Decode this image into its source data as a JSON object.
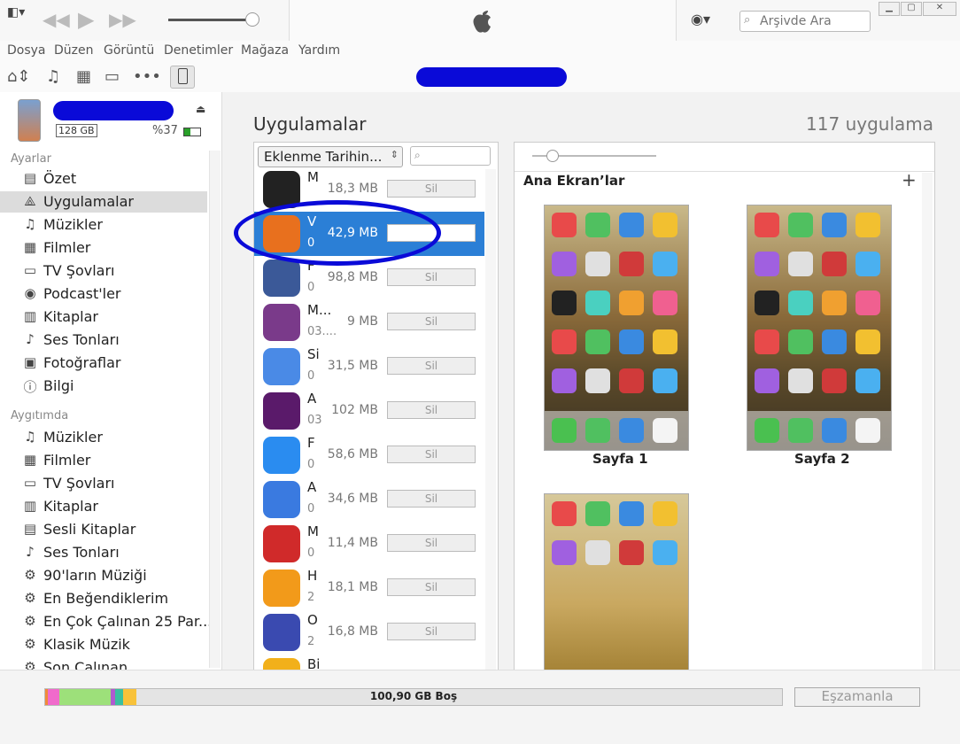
{
  "search": {
    "placeholder": "Arşivde Ara"
  },
  "menu": [
    "Dosya",
    "Düzen",
    "Görüntü",
    "Denetimler",
    "Mağaza",
    "Yardım"
  ],
  "device": {
    "capacity": "128 GB",
    "battery": "%37"
  },
  "sidebar": {
    "section_settings": "Ayarlar",
    "settings_items": [
      {
        "label": "Özet",
        "icon": "▤"
      },
      {
        "label": "Uygulamalar",
        "icon": "⟁"
      },
      {
        "label": "Müzikler",
        "icon": "♫"
      },
      {
        "label": "Filmler",
        "icon": "▦"
      },
      {
        "label": "TV Şovları",
        "icon": "▭"
      },
      {
        "label": "Podcast'ler",
        "icon": "◉"
      },
      {
        "label": "Kitaplar",
        "icon": "▥"
      },
      {
        "label": "Ses Tonları",
        "icon": "♪"
      },
      {
        "label": "Fotoğraflar",
        "icon": "▣"
      },
      {
        "label": "Bilgi",
        "icon": "ⓘ"
      }
    ],
    "section_device": "Aygıtımda",
    "device_items": [
      {
        "label": "Müzikler",
        "icon": "♫"
      },
      {
        "label": "Filmler",
        "icon": "▦"
      },
      {
        "label": "TV Şovları",
        "icon": "▭"
      },
      {
        "label": "Kitaplar",
        "icon": "▥"
      },
      {
        "label": "Sesli Kitaplar",
        "icon": "▤"
      },
      {
        "label": "Ses Tonları",
        "icon": "♪"
      },
      {
        "label": "90'ların Müziği",
        "icon": "⚙"
      },
      {
        "label": "En Beğendiklerim",
        "icon": "⚙"
      },
      {
        "label": "En Çok Çalınan 25 Par...",
        "icon": "⚙"
      },
      {
        "label": "Klasik Müzik",
        "icon": "⚙"
      },
      {
        "label": "Son Çalınan",
        "icon": "⚙"
      }
    ]
  },
  "main": {
    "title": "Uygulamalar",
    "count": "117 uygulama",
    "sort": "Eklenme Tarihin...",
    "home_screens": "Ana Ekran’lar",
    "page1": "Sayfa 1",
    "page2": "Sayfa 2"
  },
  "apps": [
    {
      "name": "M",
      "sub": "",
      "size": "18,3 MB",
      "btn": "Sil",
      "color": "#222"
    },
    {
      "name": "V",
      "sub": "0",
      "size": "42,9 MB",
      "btn": "",
      "color": "#e8701e"
    },
    {
      "name": "F",
      "sub": "0",
      "size": "98,8 MB",
      "btn": "Sil",
      "color": "#3b5998"
    },
    {
      "name": "M...",
      "sub": "03....",
      "size": "9 MB",
      "btn": "Sil",
      "color": "#7a3a8a"
    },
    {
      "name": "Si",
      "sub": "0",
      "size": "31,5 MB",
      "btn": "Sil",
      "color": "#4a8ae6"
    },
    {
      "name": "A",
      "sub": "03",
      "size": "102 MB",
      "btn": "Sil",
      "color": "#5a1a6a"
    },
    {
      "name": "F",
      "sub": "0",
      "size": "58,6 MB",
      "btn": "Sil",
      "color": "#2a8cf0"
    },
    {
      "name": "A",
      "sub": "0",
      "size": "34,6 MB",
      "btn": "Sil",
      "color": "#3a7ae0"
    },
    {
      "name": "M",
      "sub": "0",
      "size": "11,4 MB",
      "btn": "Sil",
      "color": "#d02a2a"
    },
    {
      "name": "H",
      "sub": "2",
      "size": "18,1 MB",
      "btn": "Sil",
      "color": "#f29a1a"
    },
    {
      "name": "O",
      "sub": "2",
      "size": "16,8 MB",
      "btn": "Sil",
      "color": "#3a4ab0"
    },
    {
      "name": "Bi",
      "sub": "",
      "size": "",
      "btn": "",
      "color": "#f2b01a"
    }
  ],
  "storage": {
    "free": "100,90 GB Boş"
  },
  "sync_button": "Eşzamanla"
}
